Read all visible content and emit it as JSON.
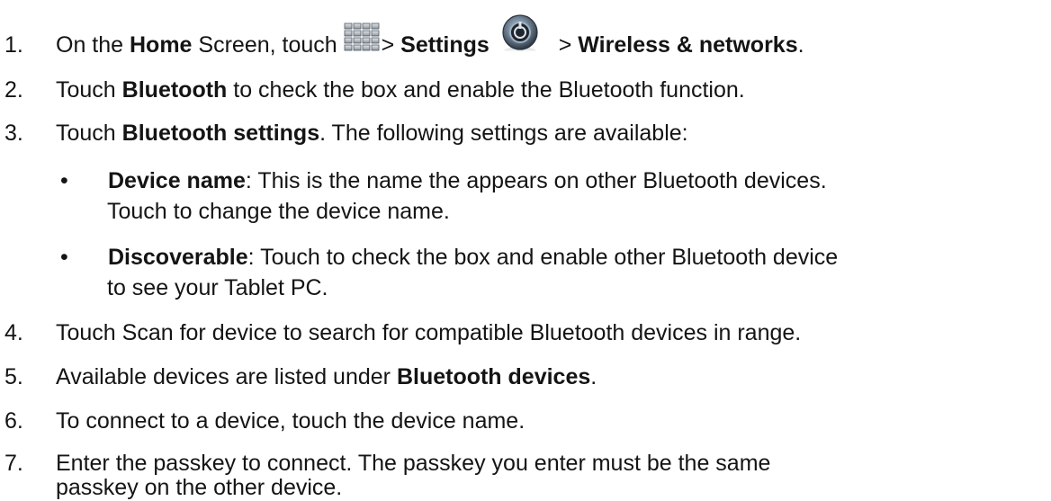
{
  "steps": [
    {
      "num": "1.",
      "t0": "On the ",
      "b0": "Home",
      "t1": " Screen, touch ",
      "t2": "> ",
      "b1": "Settings",
      "t3": " > ",
      "b2": "Wireless & networks",
      "t4": "."
    },
    {
      "num": "2.",
      "t0": "Touch ",
      "b0": "Bluetooth",
      "t1": " to check the box and enable the Bluetooth function."
    },
    {
      "num": "3.",
      "t0": "Touch ",
      "b0": "Bluetooth settings",
      "t1": ". The following settings are available:"
    },
    {
      "num": "4.",
      "t0": "Touch Scan for device to search for compatible Bluetooth devices in range."
    },
    {
      "num": "5.",
      "t0": "Available devices are listed under ",
      "b0": "Bluetooth devices",
      "t1": "."
    },
    {
      "num": "6.",
      "t0": "To connect to a device, touch the device name."
    },
    {
      "num": "7.",
      "t0": "Enter the passkey to connect. The passkey you enter must be the same",
      "t1": "passkey on the other device."
    }
  ],
  "bullets": [
    {
      "symbol": "•",
      "b0": "Device name",
      "t0": ": This is the name the appears on other Bluetooth devices.",
      "t1": "Touch to change the device name."
    },
    {
      "symbol": "•",
      "b0": "Discoverable",
      "t0": ": Touch to check the box and enable other Bluetooth device",
      "t1": "to see your Tablet PC."
    }
  ],
  "icons": {
    "apps": "app-grid-icon",
    "settings": "settings-dial-icon"
  }
}
